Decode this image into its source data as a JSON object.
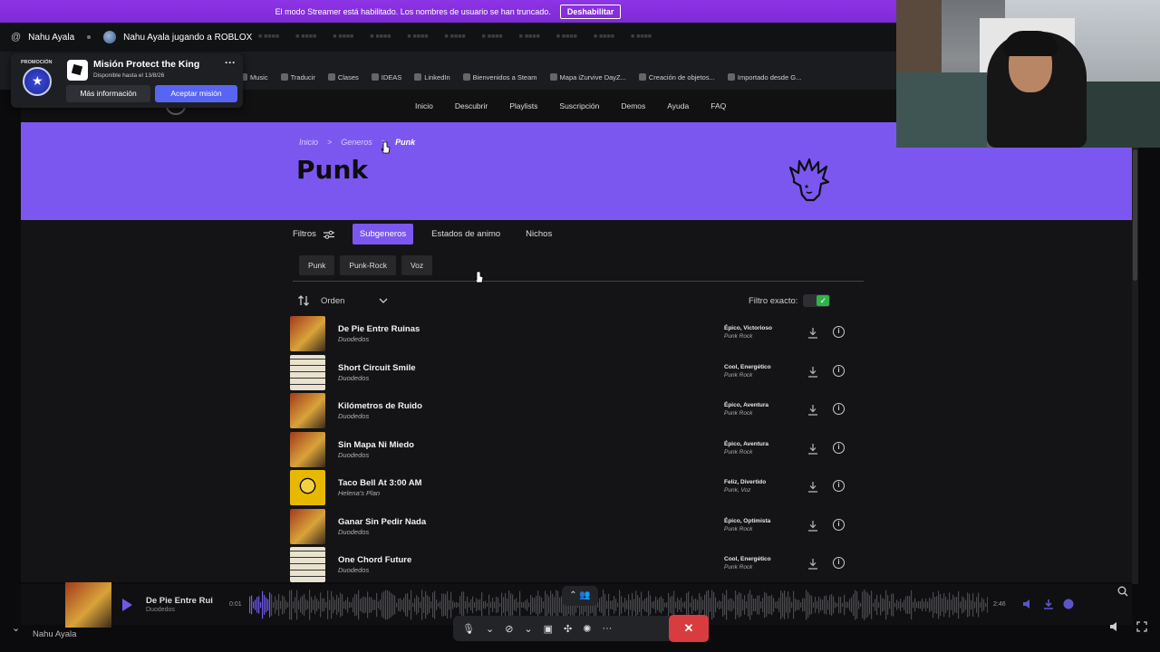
{
  "streamer_banner": {
    "message": "El modo Streamer está habilitado. Los nombres de usuario se han truncado.",
    "button": "Deshabilitar"
  },
  "discord_header": {
    "at": "@",
    "user": "Nahu Ayala",
    "activity": "Nahu Ayala jugando a ROBLOX"
  },
  "popup": {
    "tag": "PROMOCIÓN",
    "title": "Misión Protect the King",
    "subtitle": "Disponible hasta el 13/8/26",
    "more": "···",
    "btn_info": "Más información",
    "btn_accept": "Aceptar misión"
  },
  "bookmarks": [
    "Music",
    "Traducir",
    "Clases",
    "IDEAS",
    "LinkedIn",
    "Bienvenidos a Steam",
    "Mapa iZurvive DayZ...",
    "Creación de objetos...",
    "Importado desde G..."
  ],
  "site_nav": [
    "Inicio",
    "Descubrir",
    "Playlists",
    "Suscripción",
    "Demos",
    "Ayuda",
    "FAQ"
  ],
  "breadcrumb": {
    "home": "Inicio",
    "sep": ">",
    "genres": "Generos",
    "current": "Punk"
  },
  "page_title": "Punk",
  "filters": {
    "label": "Filtros",
    "tabs": [
      "Subgeneros",
      "Estados de animo",
      "Nichos"
    ]
  },
  "subgenres": [
    "Punk",
    "Punk-Rock",
    "Voz"
  ],
  "sort": {
    "label": "Orden",
    "exact_label": "Filtro exacto:"
  },
  "tracks": [
    {
      "title": "De Pie Entre Ruinas",
      "artist": "Duodedos",
      "mood": "Épico, Victorioso",
      "genre": "Punk Rock"
    },
    {
      "title": "Short Circuit Smile",
      "artist": "Duodedos",
      "mood": "Cool, Energético",
      "genre": "Punk Rock"
    },
    {
      "title": "Kilómetros de Ruido",
      "artist": "Duodedos",
      "mood": "Épico, Aventura",
      "genre": "Punk Rock"
    },
    {
      "title": "Sin Mapa Ni Miedo",
      "artist": "Duodedos",
      "mood": "Épico, Aventura",
      "genre": "Punk Rock"
    },
    {
      "title": "Taco Bell At 3:00 AM",
      "artist": "Helena's Plan",
      "mood": "Feliz, Divertido",
      "genre": "Punk, Voz"
    },
    {
      "title": "Ganar Sin Pedir Nada",
      "artist": "Duodedos",
      "mood": "Épico, Optimista",
      "genre": "Punk Rock"
    },
    {
      "title": "One Chord Future",
      "artist": "Duodedos",
      "mood": "Cool, Energético",
      "genre": "Punk Rock"
    }
  ],
  "player": {
    "title": "De Pie Entre Rui",
    "artist": "Duodedos",
    "time": "0:01",
    "duration": "2:46"
  },
  "call": {
    "self_label": "Nahu Ayala"
  }
}
